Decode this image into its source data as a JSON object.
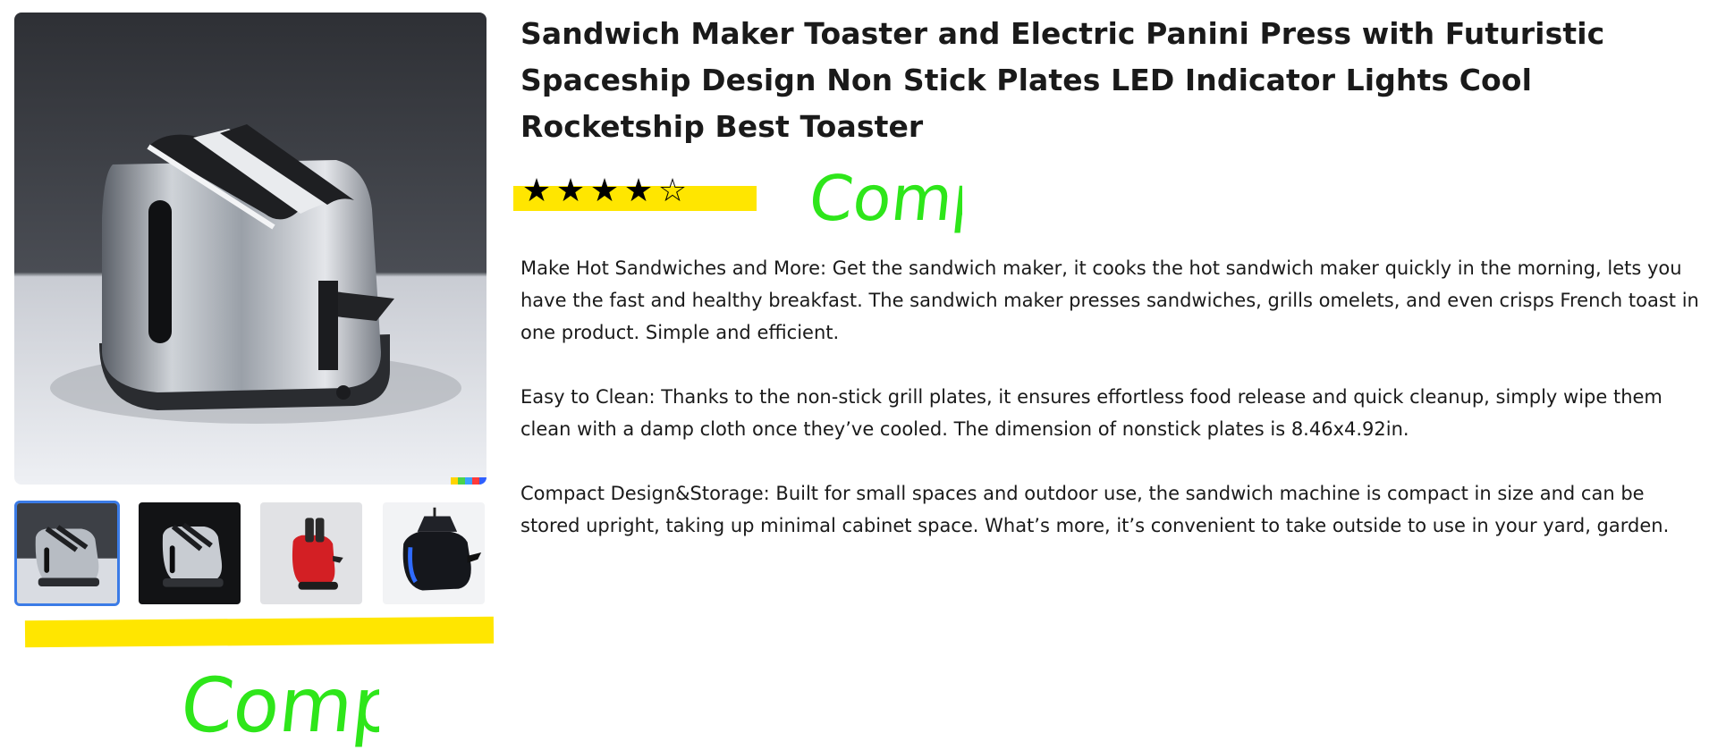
{
  "product": {
    "title": "Sandwich Maker Toaster and Electric Panini Press with Futuristic Spaceship Design Non Stick Plates LED Indicator Lights Cool Rocketship Best Toaster",
    "rating": 4,
    "rating_max": 5,
    "stars": [
      "★",
      "★",
      "★",
      "★",
      "☆"
    ],
    "description": [
      "Make Hot Sandwiches and More: Get the  sandwich maker, it cooks the hot sandwich maker quickly in the morning, lets you have the fast and healthy breakfast. The sandwich maker presses sandwiches, grills omelets, and even crisps French toast in one product. Simple and efficient.",
      "Easy to Clean: Thanks to the non-stick grill plates, it ensures effortless food release and quick cleanup, simply wipe them clean with a damp cloth once they’ve cooled. The dimension of nonstick plates is 8.46x4.92in.",
      "Compact Design&Storage: Built for small spaces and outdoor use, the sandwich machine is compact in size and can be stored upright, taking up minimal cabinet space. What’s more, it’s convenient to take outside to use in your yard, garden."
    ]
  },
  "gallery": {
    "main_image_icon": "silver-toaster-image",
    "thumbnails": [
      {
        "icon": "silver-toaster-thumbnail",
        "selected": true
      },
      {
        "icon": "dark-toaster-thumbnail",
        "selected": false
      },
      {
        "icon": "red-toaster-thumbnail",
        "selected": false
      },
      {
        "icon": "blue-black-toaster-thumbnail",
        "selected": false
      }
    ]
  },
  "annotations": {
    "handwritten_1": "Comp",
    "handwritten_2": "Comp",
    "highlight_color": "#ffe600",
    "ink_color": "#2ee61a"
  },
  "colors": {
    "selected_border": "#3b7be6",
    "text": "#1a1a1a"
  }
}
